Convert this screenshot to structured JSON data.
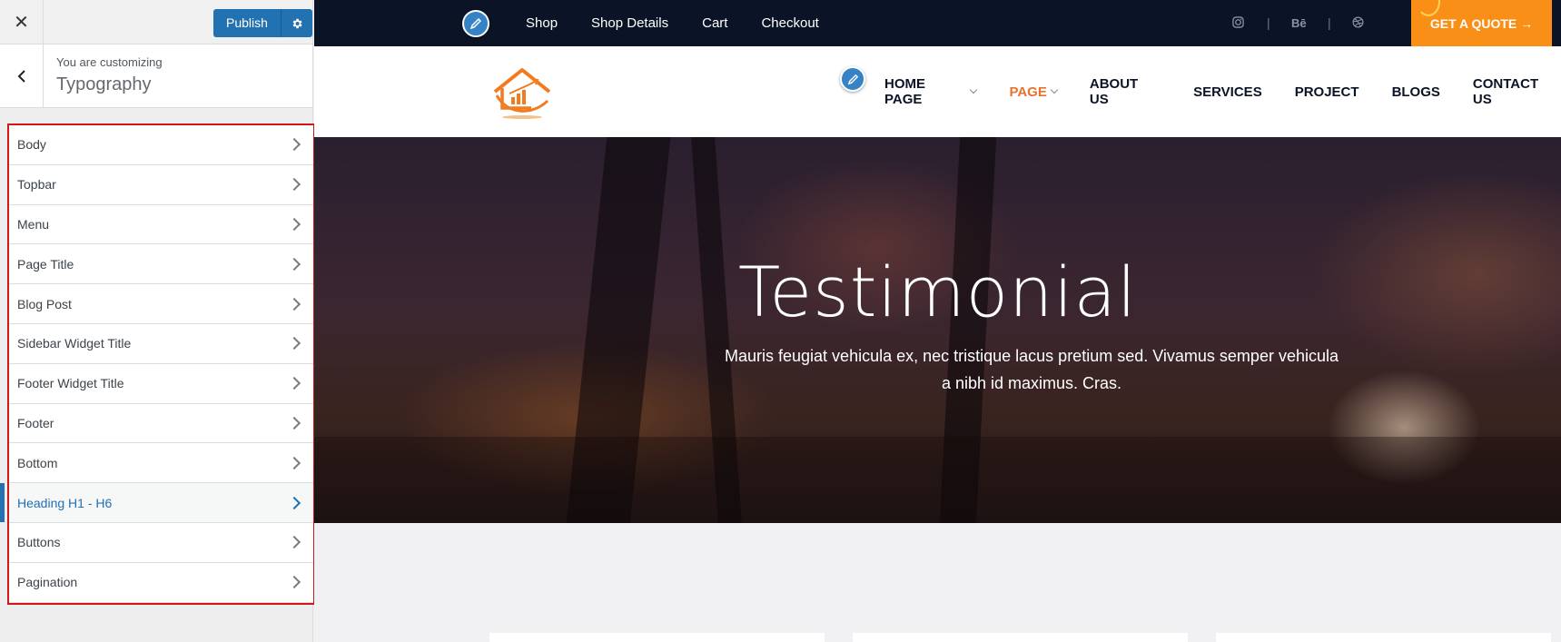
{
  "sidebar": {
    "close_icon": "close-icon",
    "publish_label": "Publish",
    "settings_icon": "gear-icon",
    "customizing_label": "You are customizing",
    "section_title": "Typography",
    "items": [
      {
        "label": "Body",
        "active": false
      },
      {
        "label": "Topbar",
        "active": false
      },
      {
        "label": "Menu",
        "active": false
      },
      {
        "label": "Page Title",
        "active": false
      },
      {
        "label": "Blog Post",
        "active": false
      },
      {
        "label": "Sidebar Widget Title",
        "active": false
      },
      {
        "label": "Footer Widget Title",
        "active": false
      },
      {
        "label": "Footer",
        "active": false
      },
      {
        "label": "Bottom",
        "active": false
      },
      {
        "label": "Heading H1 - H6",
        "active": true
      },
      {
        "label": "Buttons",
        "active": false
      },
      {
        "label": "Pagination",
        "active": false
      }
    ]
  },
  "topbar": {
    "links": [
      "Shop",
      "Shop Details",
      "Cart",
      "Checkout"
    ],
    "socials": [
      "instagram-icon",
      "behance-icon",
      "dribbble-icon"
    ],
    "behance_text": "Bē",
    "quote_label": "GET A QUOTE →"
  },
  "mainnav": {
    "items": [
      {
        "label": "HOME PAGE",
        "dropdown": true,
        "current": false
      },
      {
        "label": "PAGE",
        "dropdown": true,
        "current": true
      },
      {
        "label": "ABOUT US",
        "dropdown": false,
        "current": false
      },
      {
        "label": "SERVICES",
        "dropdown": false,
        "current": false
      },
      {
        "label": "PROJECT",
        "dropdown": false,
        "current": false
      },
      {
        "label": "BLOGS",
        "dropdown": false,
        "current": false
      },
      {
        "label": "CONTACT US",
        "dropdown": false,
        "current": false
      }
    ]
  },
  "hero": {
    "title": "Testimonial",
    "text": "Mauris feugiat vehicula ex, nec tristique lacus pretium sed. Vivamus semper vehicula a nibh id maximus. Cras."
  },
  "colors": {
    "accent": "#f98f17",
    "active_nav": "#e9732c",
    "topbar_bg": "#0b1426",
    "wp_blue": "#2271b1",
    "highlight_border": "#d0181b"
  }
}
